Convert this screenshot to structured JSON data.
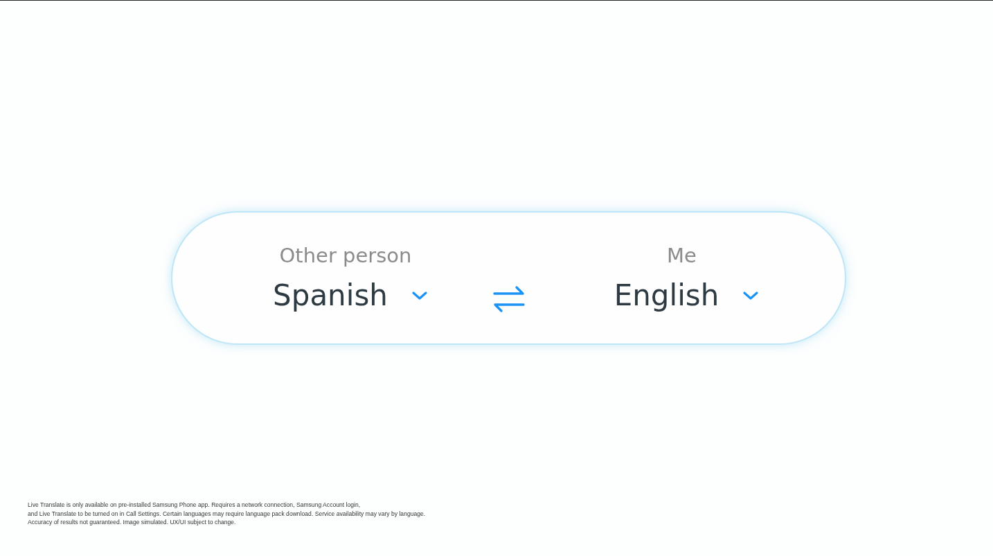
{
  "translate_card": {
    "sides": [
      {
        "label": "Other person",
        "language": "Spanish"
      },
      {
        "label": "Me",
        "language": "English"
      }
    ]
  },
  "disclaimer": [
    "Live Translate is only available on pre-installed Samsung Phone app. Requires a network connection, Samsung Account login,",
    "and Live Translate to be turned on in Call Settings. Certain languages may require language pack download. Service availability may vary by language.",
    "Accuracy of results not guaranteed. Image simulated. UX/UI subject to change."
  ]
}
